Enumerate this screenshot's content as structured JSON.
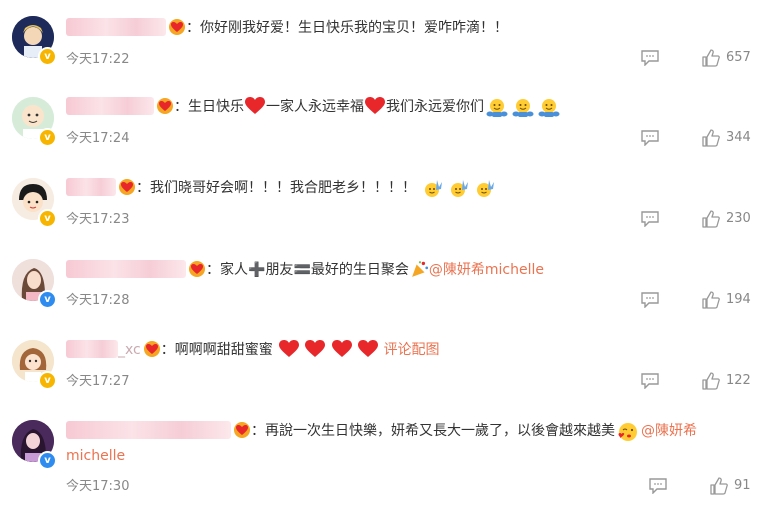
{
  "comments": [
    {
      "text": "：你好刚我好爱！生日快乐我的宝贝！爱咋咋滴！！",
      "time": "今天17:22",
      "likes": "657"
    },
    {
      "text_a": "：生日快乐",
      "text_b": "一家人永远幸福",
      "text_c": "我们永远爱你们",
      "time": "今天17:24",
      "likes": "344"
    },
    {
      "text": "：我们晓哥好会啊！！！我合肥老乡！！！！",
      "time": "今天17:23",
      "likes": "230"
    },
    {
      "text_a": "：家人",
      "text_b": "朋友",
      "text_c": "最好的生日聚会",
      "mention": "@陳妍希michelle",
      "time": "今天17:28",
      "likes": "194"
    },
    {
      "name_suffix": "_xc",
      "text": "：啊啊啊甜甜蜜蜜",
      "trailing": "评论配图",
      "time": "今天17:27",
      "likes": "122"
    },
    {
      "text": "：再說一次生日快樂，妍希又長大一歲了，以後會越來越美",
      "mention": "@陳妍希",
      "mention_cont": "michelle",
      "time": "今天17:30",
      "likes": "91"
    }
  ],
  "icons": {
    "reply": "comment-icon",
    "like": "thumbs-up-icon",
    "fan": "fan-badge-icon",
    "heart": "red-heart-icon"
  },
  "colors": {
    "mention": "#eb7350",
    "meta": "#888888",
    "heart": "#e8272b",
    "gold_badge": "#f7b500",
    "blue_badge": "#2e8cf0"
  }
}
